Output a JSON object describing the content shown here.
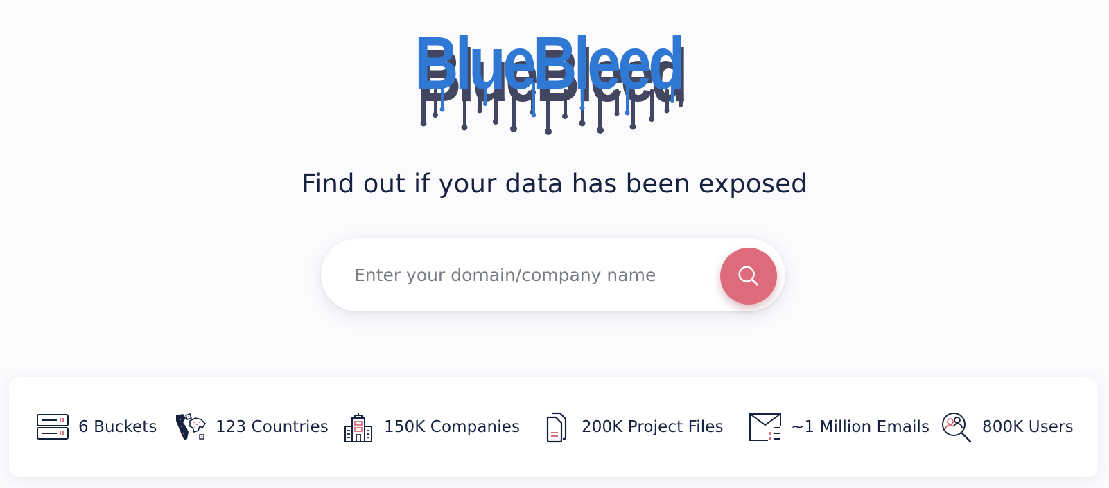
{
  "brand": {
    "logo_text": "BlueBleed",
    "logo_color": "#2f78d4",
    "drip_color": "#434660"
  },
  "headline": "Find out if your data has been exposed",
  "search": {
    "placeholder": "Enter your domain/company name",
    "value": "",
    "button_icon": "search-icon",
    "button_color": "#de6b7b"
  },
  "stats": [
    {
      "icon": "server-icon",
      "label": "6 Buckets"
    },
    {
      "icon": "world-map-icon",
      "label": "123 Countries"
    },
    {
      "icon": "building-icon",
      "label": "150K Companies"
    },
    {
      "icon": "documents-icon",
      "label": "200K Project Files"
    },
    {
      "icon": "envelope-list-icon",
      "label": "~1 Million Emails"
    },
    {
      "icon": "users-search-icon",
      "label": "800K Users"
    }
  ],
  "colors": {
    "text": "#15223f",
    "accent": "#de6b7b",
    "background": "#fbfafd"
  }
}
